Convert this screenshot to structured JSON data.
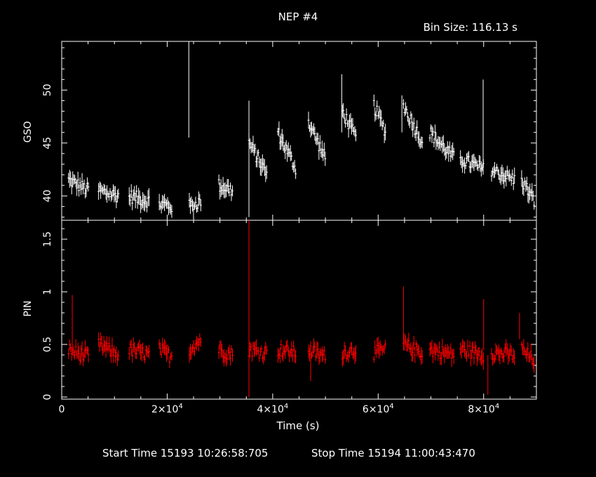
{
  "title": "NEP #4",
  "bin_size": "Bin Size: 116.13 s",
  "footer": {
    "start": "Start Time 15193 10:26:58:705",
    "stop": "Stop Time 15194 11:00:43:470"
  },
  "colors": {
    "background": "#000000",
    "axes": "#ffffff",
    "gso": "#ffffff",
    "pin": "#ff0000"
  },
  "chart_data": [
    {
      "type": "scatter",
      "panel": "top",
      "ylabel": "GSO",
      "xlim": [
        0,
        90000
      ],
      "ylim": [
        37.7,
        54.6
      ],
      "y_ticks": [
        40,
        45,
        50
      ],
      "x_ticks": [
        0,
        20000,
        40000,
        60000,
        80000
      ],
      "grid": false,
      "series": [
        {
          "color": "#ffffff",
          "segments": [
            {
              "t0": 1300,
              "t1": 5200,
              "y0": 41.5,
              "y1": 40.5
            },
            {
              "t0": 7000,
              "t1": 10800,
              "y0": 40.5,
              "y1": 40.0
            },
            {
              "t0": 12800,
              "t1": 16600,
              "y0": 40.0,
              "y1": 39.5
            },
            {
              "t0": 18500,
              "t1": 21000,
              "y0": 39.3,
              "y1": 39.0
            },
            {
              "t0": 24200,
              "t1": 26500,
              "y0": 39.0,
              "y1": 39.5
            },
            {
              "t0": 29800,
              "t1": 32500,
              "y0": 41.0,
              "y1": 40.5
            },
            {
              "t0": 35500,
              "t1": 39000,
              "y0": 45.0,
              "y1": 42.0
            },
            {
              "t0": 41000,
              "t1": 44500,
              "y0": 46.0,
              "y1": 42.5
            },
            {
              "t0": 46800,
              "t1": 50000,
              "y0": 47.0,
              "y1": 43.5
            },
            {
              "t0": 53200,
              "t1": 55800,
              "y0": 48.0,
              "y1": 45.5
            },
            {
              "t0": 59200,
              "t1": 61500,
              "y0": 48.5,
              "y1": 46.0
            },
            {
              "t0": 64800,
              "t1": 68500,
              "y0": 48.5,
              "y1": 45.0
            },
            {
              "t0": 69800,
              "t1": 74500,
              "y0": 46.0,
              "y1": 43.5
            },
            {
              "t0": 75600,
              "t1": 80000,
              "y0": 43.5,
              "y1": 42.5
            },
            {
              "t0": 81500,
              "t1": 86000,
              "y0": 42.5,
              "y1": 41.5
            },
            {
              "t0": 87200,
              "t1": 89600,
              "y0": 41.5,
              "y1": 39.5
            }
          ],
          "spikes": [
            {
              "t": 24100,
              "y0": 45.5,
              "y1": 54.6
            },
            {
              "t": 35500,
              "y0": 38.0,
              "y1": 49.0
            },
            {
              "t": 79900,
              "y0": 42.0,
              "y1": 51.0
            },
            {
              "t": 53100,
              "y0": 46.0,
              "y1": 51.5
            },
            {
              "t": 64500,
              "y0": 46.0,
              "y1": 49.5
            }
          ]
        }
      ]
    },
    {
      "type": "scatter",
      "panel": "bottom",
      "xlabel": "Time (s)",
      "ylabel": "PIN",
      "xlim": [
        0,
        90000
      ],
      "ylim": [
        -0.02,
        1.68
      ],
      "y_ticks": [
        0,
        0.5,
        1,
        1.5
      ],
      "x_ticks": [
        0,
        20000,
        40000,
        60000,
        80000
      ],
      "grid": false,
      "series": [
        {
          "color": "#ff0000",
          "segments": [
            {
              "t0": 1300,
              "t1": 5200,
              "y0": 0.45,
              "y1": 0.38
            },
            {
              "t0": 7000,
              "t1": 10800,
              "y0": 0.5,
              "y1": 0.4
            },
            {
              "t0": 12800,
              "t1": 16600,
              "y0": 0.45,
              "y1": 0.4
            },
            {
              "t0": 18500,
              "t1": 21000,
              "y0": 0.45,
              "y1": 0.38
            },
            {
              "t0": 24200,
              "t1": 26500,
              "y0": 0.45,
              "y1": 0.55
            },
            {
              "t0": 29800,
              "t1": 32500,
              "y0": 0.45,
              "y1": 0.4
            },
            {
              "t0": 35500,
              "t1": 39000,
              "y0": 0.45,
              "y1": 0.42
            },
            {
              "t0": 41000,
              "t1": 44500,
              "y0": 0.45,
              "y1": 0.42
            },
            {
              "t0": 46800,
              "t1": 50000,
              "y0": 0.45,
              "y1": 0.38
            },
            {
              "t0": 53200,
              "t1": 55800,
              "y0": 0.42,
              "y1": 0.45
            },
            {
              "t0": 59200,
              "t1": 61500,
              "y0": 0.42,
              "y1": 0.45
            },
            {
              "t0": 64800,
              "t1": 68500,
              "y0": 0.5,
              "y1": 0.42
            },
            {
              "t0": 69800,
              "t1": 74500,
              "y0": 0.45,
              "y1": 0.4
            },
            {
              "t0": 75600,
              "t1": 80000,
              "y0": 0.45,
              "y1": 0.4
            },
            {
              "t0": 81500,
              "t1": 86000,
              "y0": 0.42,
              "y1": 0.4
            },
            {
              "t0": 87200,
              "t1": 89600,
              "y0": 0.45,
              "y1": 0.35
            }
          ],
          "spikes": [
            {
              "t": 35500,
              "y0": 0.0,
              "y1": 1.68
            },
            {
              "t": 2000,
              "y0": 0.5,
              "y1": 0.97
            },
            {
              "t": 64800,
              "y0": 0.5,
              "y1": 1.05
            },
            {
              "t": 80000,
              "y0": 0.45,
              "y1": 0.93
            },
            {
              "t": 80800,
              "y0": 0.02,
              "y1": 0.4
            },
            {
              "t": 47200,
              "y0": 0.15,
              "y1": 0.45
            },
            {
              "t": 86800,
              "y0": 0.55,
              "y1": 0.8
            }
          ]
        }
      ]
    }
  ]
}
